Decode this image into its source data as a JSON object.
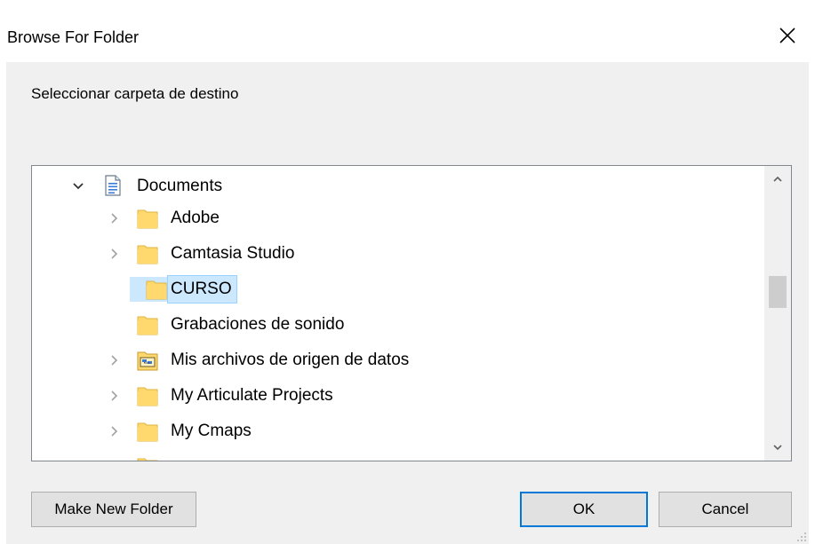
{
  "window": {
    "title": "Browse For Folder",
    "close_icon": "close-icon"
  },
  "dialog": {
    "instruction": "Seleccionar carpeta de destino"
  },
  "tree": {
    "root": {
      "label": "Documents",
      "expanded": true,
      "icon": "documents-library-icon"
    },
    "items": [
      {
        "label": "Adobe",
        "has_children": true,
        "icon": "folder-icon",
        "selected": false
      },
      {
        "label": "Camtasia Studio",
        "has_children": true,
        "icon": "folder-icon",
        "selected": false
      },
      {
        "label": "CURSO",
        "has_children": false,
        "icon": "folder-icon",
        "selected": true
      },
      {
        "label": "Grabaciones de sonido",
        "has_children": false,
        "icon": "folder-icon",
        "selected": false
      },
      {
        "label": "Mis archivos de origen de datos",
        "has_children": true,
        "icon": "data-sources-folder-icon",
        "selected": false
      },
      {
        "label": "My Articulate Projects",
        "has_children": true,
        "icon": "folder-icon",
        "selected": false
      },
      {
        "label": "My Cmaps",
        "has_children": true,
        "icon": "folder-icon",
        "selected": false
      }
    ],
    "scroll_position": 0.4
  },
  "buttons": {
    "make_new_folder": "Make New Folder",
    "ok": "OK",
    "cancel": "Cancel"
  },
  "colors": {
    "selection_bg": "#cce8ff",
    "folder_yellow": "#ffd86e",
    "default_button_border": "#0078d7"
  }
}
